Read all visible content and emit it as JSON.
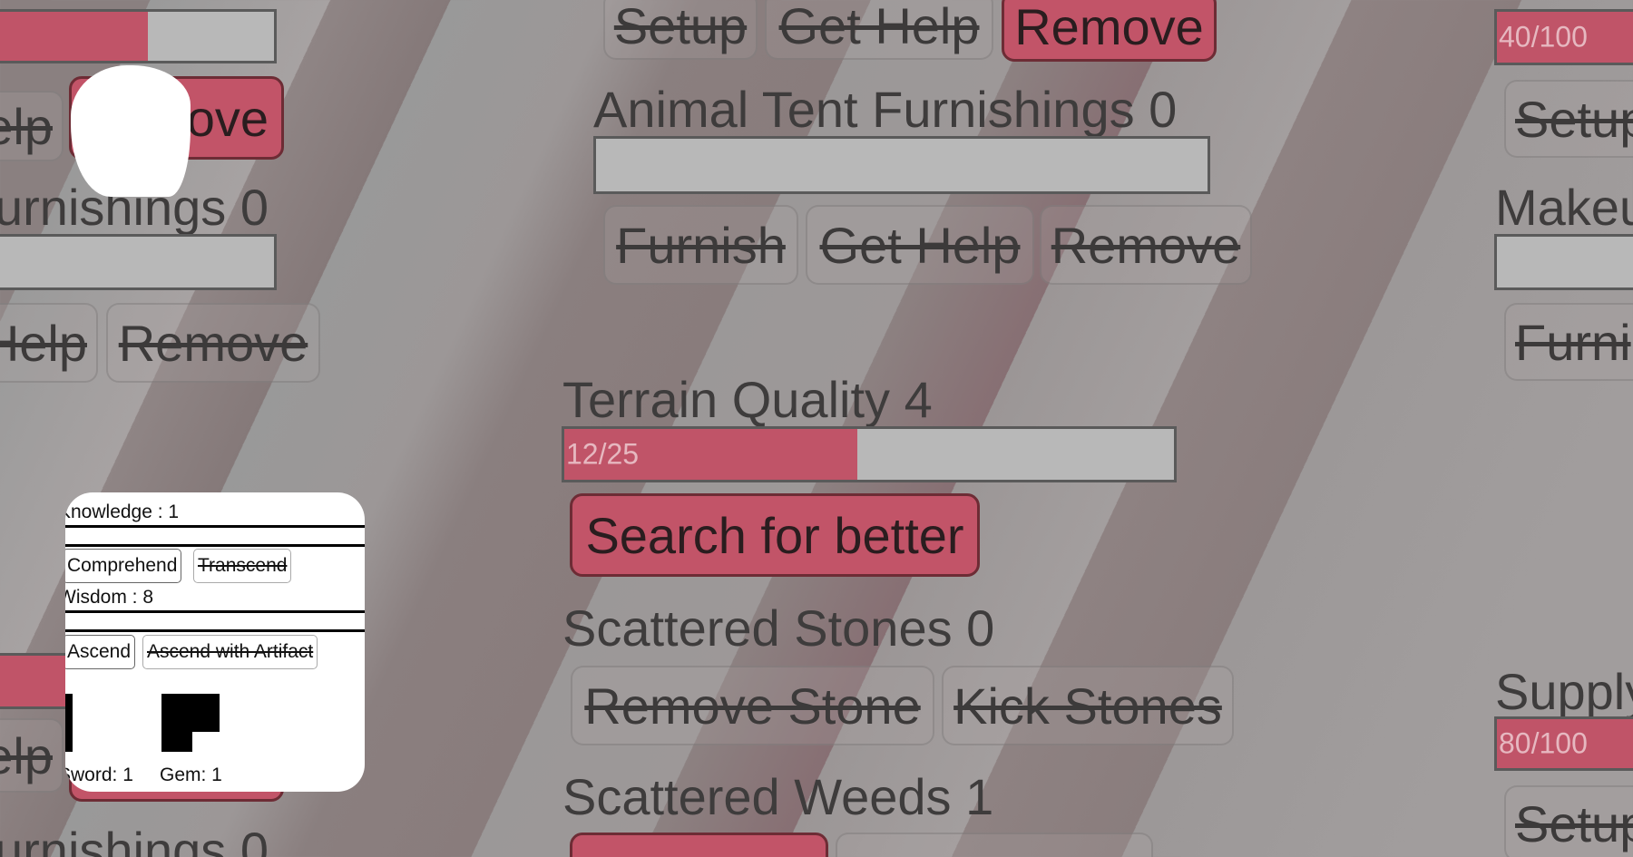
{
  "left_column": {
    "top_progress_pct": 55,
    "btn_help_partial": "elp",
    "btn_remove_partial": "ove",
    "furnishings_label_partial": "urnishings 0",
    "btn_help2_partial": "Help",
    "btn_remove2": "Remove",
    "btn_help3_partial": "elp",
    "furnishings_label2_partial": "urnishings 0"
  },
  "center": {
    "top_buttons": [
      "Setup",
      "Get Help",
      "Remove"
    ],
    "animal_tent_label": "Animal Tent Furnishings 0",
    "animal_tent_pct": 0,
    "furnish_buttons": [
      "Furnish",
      "Get Help",
      "Remove"
    ],
    "terrain_label": "Terrain Quality 4",
    "terrain_text": "12/25",
    "terrain_pct": 48,
    "search_button": "Search for better",
    "stones_label": "Scattered Stones 0",
    "stones_buttons": [
      "Remove Stone",
      "Kick Stones"
    ],
    "weeds_label": "Scattered Weeds 1"
  },
  "right_column": {
    "top_bar_text": "40/100",
    "top_bar_pct": 40,
    "setup_partial": "Setup",
    "makeup_partial": "Makeu",
    "furni_partial": "Furni",
    "supply_partial": "Supply",
    "supply_bar_text": "80/100",
    "supply_bar_pct": 80,
    "setup2_partial": "Setup"
  },
  "popup": {
    "knowledge": "Knowledge : 1",
    "comprehend": "Comprehend",
    "transcend": "Transcend",
    "wisdom": "Wisdom : 8",
    "ascend": "Ascend",
    "ascend_artifact": "Ascend with Artifact",
    "sword": "Sword: 1",
    "gem": "Gem: 1"
  }
}
